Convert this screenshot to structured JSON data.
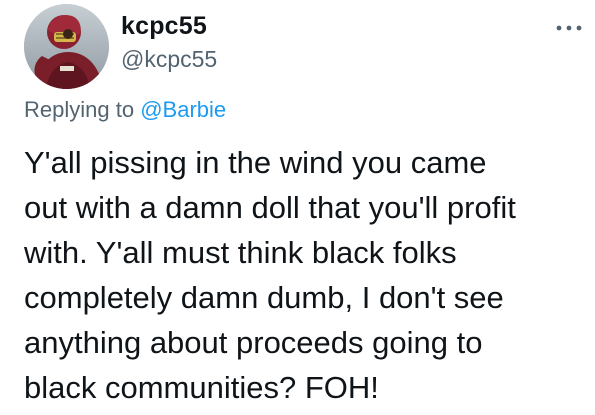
{
  "author": {
    "display_name": "kcpc55",
    "handle": "@kcpc55",
    "avatar": "football-player-photo"
  },
  "header": {
    "more_icon": "more-horizontal-icon"
  },
  "reply": {
    "prefix": "Replying to",
    "mention": "@Barbie"
  },
  "tweet": {
    "lines": [
      "Y'all pissing in the wind you came",
      "out with a damn doll that you'll profit",
      "with. Y'all must think black folks",
      "completely damn dumb, I don't see",
      "anything about proceeds going to",
      "black communities? FOH!"
    ]
  },
  "colors": {
    "text_primary": "#0f1419",
    "text_secondary": "#536471",
    "accent": "#1d9bf0"
  }
}
